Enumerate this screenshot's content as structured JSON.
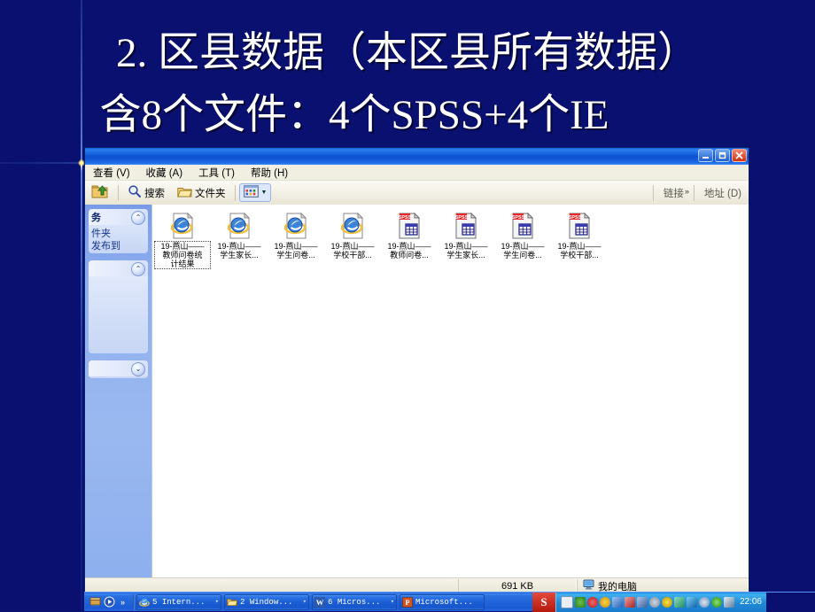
{
  "slide": {
    "title_line1": "2. 区县数据（本区县所有数据）",
    "title_line2": "含8个文件：4个SPSS+4个IE",
    "background_color": "#0a1070",
    "text_color": "#ffffff"
  },
  "explorer": {
    "window_buttons": {
      "minimize": "_",
      "maximize": "□",
      "close": "✕"
    },
    "menu": [
      {
        "label": "查看 (V)"
      },
      {
        "label": "收藏 (A)"
      },
      {
        "label": "工具 (T)"
      },
      {
        "label": "帮助 (H)"
      }
    ],
    "toolbar": {
      "up_icon": "up-folder-icon",
      "search_label": "搜索",
      "folders_label": "文件夹",
      "views_icon": "views-icon",
      "links_label": "链接",
      "links_chevron": "»",
      "address_label": "地址 (D)"
    },
    "sidebar": {
      "panels": [
        {
          "title": "务",
          "collapse_glyph": "⌃",
          "links": [
            "件夹",
            "发布到"
          ]
        },
        {
          "title": "",
          "collapse_glyph": "⌃",
          "links": []
        },
        {
          "title": "",
          "collapse_glyph": "⌄",
          "links": []
        }
      ]
    },
    "files": [
      {
        "name": "19-燕山——\n教师问卷统\n计结果",
        "type": "ie-html-icon",
        "selected": true
      },
      {
        "name": "19-燕山——\n学生家长...",
        "type": "ie-html-icon",
        "selected": false
      },
      {
        "name": "19-燕山——\n学生问卷...",
        "type": "ie-html-icon",
        "selected": false
      },
      {
        "name": "19-燕山——\n学校干部...",
        "type": "ie-html-icon",
        "selected": false
      },
      {
        "name": "19-燕山——\n教师问卷...",
        "type": "spss-sav-icon",
        "selected": false
      },
      {
        "name": "19-燕山——\n学生家长...",
        "type": "spss-sav-icon",
        "selected": false
      },
      {
        "name": "19-燕山——\n学生问卷...",
        "type": "spss-sav-icon",
        "selected": false
      },
      {
        "name": "19-燕山——\n学校干部...",
        "type": "spss-sav-icon",
        "selected": false
      }
    ],
    "statusbar": {
      "size": "691 KB",
      "location_icon": "my-computer-icon",
      "location": "我的电脑"
    }
  },
  "taskbar": {
    "quicklaunch_chevron": "»",
    "buttons": [
      {
        "label": "5 Intern...",
        "icon": "ie-icon",
        "caret": "▾"
      },
      {
        "label": "2 Window...",
        "icon": "folder-icon",
        "caret": "▾"
      },
      {
        "label": "6 Micros...",
        "icon": "word-icon",
        "caret": "▾"
      },
      {
        "label": "Microsoft...",
        "icon": "powerpoint-icon",
        "caret": ""
      }
    ],
    "tray_badge": "S",
    "clock": "22:06"
  }
}
